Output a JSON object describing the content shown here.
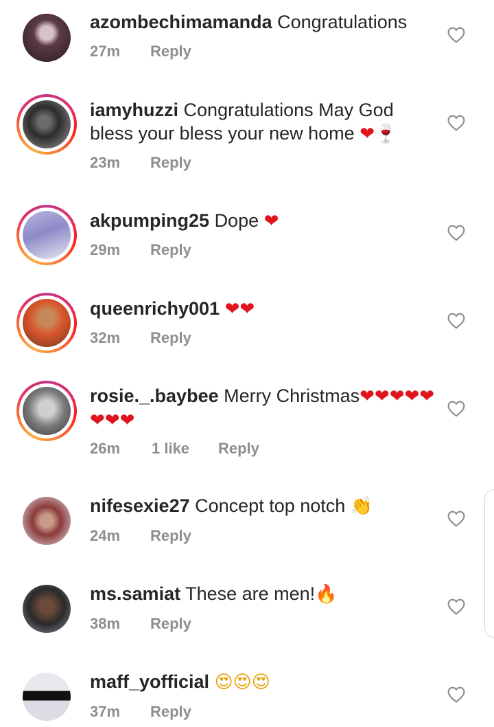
{
  "comments": [
    {
      "user": "azombechimamanda",
      "text": "Congratulations",
      "emoji": "",
      "time": "27m",
      "likes": "",
      "reply": "Reply"
    },
    {
      "user": "iamyhuzzi",
      "text": "Congratulations May God bless your bless your new home",
      "emoji": "❤🍷",
      "time": "23m",
      "likes": "",
      "reply": "Reply"
    },
    {
      "user": "akpumping25",
      "text": "Dope",
      "emoji": "❤",
      "time": "29m",
      "likes": "",
      "reply": "Reply"
    },
    {
      "user": "queenrichy001",
      "text": "",
      "emoji": "❤❤",
      "time": "32m",
      "likes": "",
      "reply": "Reply"
    },
    {
      "user": "rosie._.baybee",
      "text": "Merry Christmas",
      "emoji": "❤❤❤❤❤❤❤❤",
      "time": "26m",
      "likes": "1 like",
      "reply": "Reply"
    },
    {
      "user": "nifesexie27",
      "text": "Concept top notch",
      "emoji": "👏",
      "time": "24m",
      "likes": "",
      "reply": "Reply"
    },
    {
      "user": "ms.samiat",
      "text": "These are men!",
      "emoji": "🔥",
      "time": "38m",
      "likes": "",
      "reply": "Reply"
    },
    {
      "user": "maff_yofficial",
      "text": "",
      "emoji": "😍😍😍",
      "time": "37m",
      "likes": "",
      "reply": "Reply"
    }
  ],
  "colors": {
    "ring": "#e1306c",
    "heart_emoji": "#e0151c",
    "meta": "#8e8e8e"
  }
}
